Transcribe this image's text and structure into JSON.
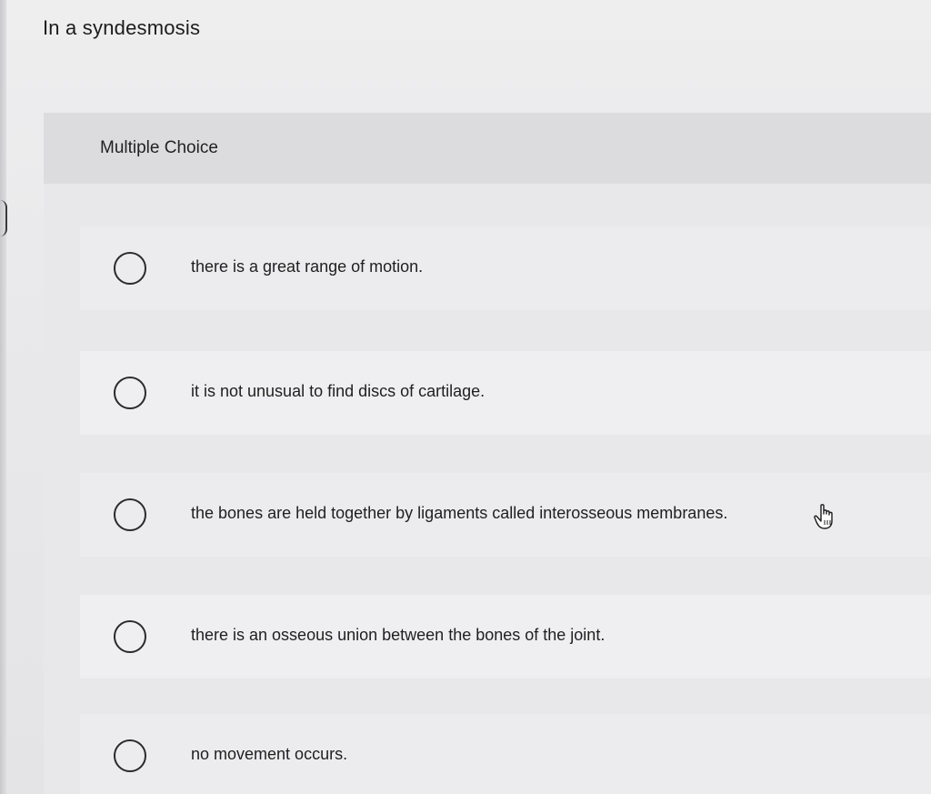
{
  "question": {
    "title": "In a syndesmosis",
    "type_label": "Multiple Choice"
  },
  "options": [
    {
      "label": "there is a great range of motion."
    },
    {
      "label": "it is not unusual to find discs of cartilage."
    },
    {
      "label": "the bones are held together by ligaments called interosseous membranes."
    },
    {
      "label": "there is an osseous union between the bones of the joint."
    },
    {
      "label": "no movement occurs."
    }
  ],
  "icons": {
    "radio": "radio-unselected-icon",
    "cursor": "hand-pointer-icon"
  }
}
